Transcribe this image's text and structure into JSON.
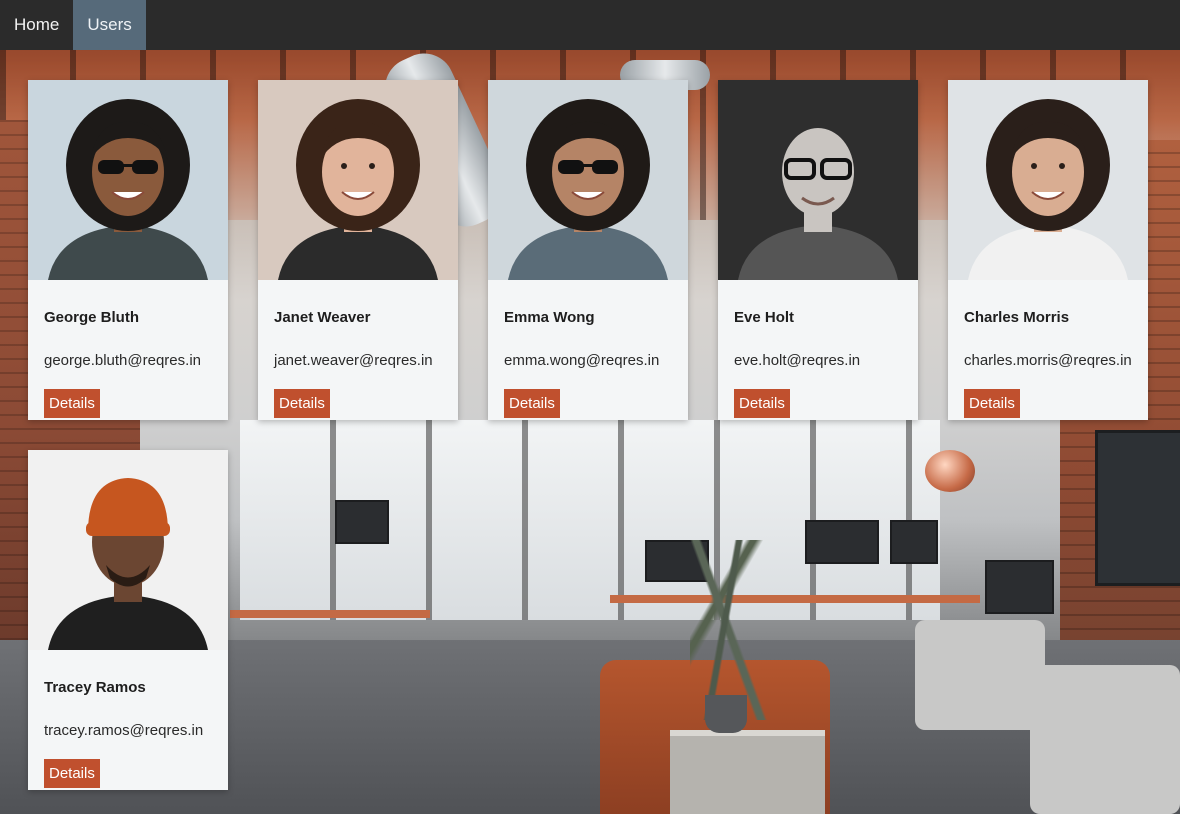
{
  "nav": {
    "items": [
      {
        "label": "Home",
        "active": false
      },
      {
        "label": "Users",
        "active": true
      }
    ]
  },
  "colors": {
    "navbar_bg": "#2b2b2b",
    "nav_active_bg": "#566a7a",
    "card_bg": "#f4f6f7",
    "button_bg": "#c0502e"
  },
  "users": [
    {
      "name": "George Bluth",
      "email": "george.bluth@reqres.in",
      "button_label": "Details",
      "photo": {
        "bg": "#c9d6de",
        "skin": "#8a5a3c",
        "hair": "#1d1a18",
        "shirt": "#3f4a4c",
        "accessory": "sunglasses"
      }
    },
    {
      "name": "Janet Weaver",
      "email": "janet.weaver@reqres.in",
      "button_label": "Details",
      "photo": {
        "bg": "#d8c9bf",
        "skin": "#e1b49b",
        "hair": "#3a2418",
        "shirt": "#2b2b2b",
        "accessory": "none"
      }
    },
    {
      "name": "Emma Wong",
      "email": "emma.wong@reqres.in",
      "button_label": "Details",
      "photo": {
        "bg": "#cfd7dc",
        "skin": "#b58466",
        "hair": "#1f1a17",
        "shirt": "#5a6c78",
        "accessory": "sunglasses"
      }
    },
    {
      "name": "Eve Holt",
      "email": "eve.holt@reqres.in",
      "button_label": "Details",
      "photo": {
        "bg": "#2e2e2e",
        "skin": "#c9c5c1",
        "hair": "#c9c5c1",
        "shirt": "#555555",
        "accessory": "glasses"
      }
    },
    {
      "name": "Charles Morris",
      "email": "charles.morris@reqres.in",
      "button_label": "Details",
      "photo": {
        "bg": "#dfe3e6",
        "skin": "#d9ad92",
        "hair": "#2a1f1a",
        "shirt": "#f1f1f1",
        "accessory": "none"
      }
    },
    {
      "name": "Tracey Ramos",
      "email": "tracey.ramos@reqres.in",
      "button_label": "Details",
      "photo": {
        "bg": "#f1f1f1",
        "skin": "#6b4632",
        "hair": "#c6561f",
        "shirt": "#1f1f1f",
        "accessory": "beanie"
      }
    }
  ]
}
